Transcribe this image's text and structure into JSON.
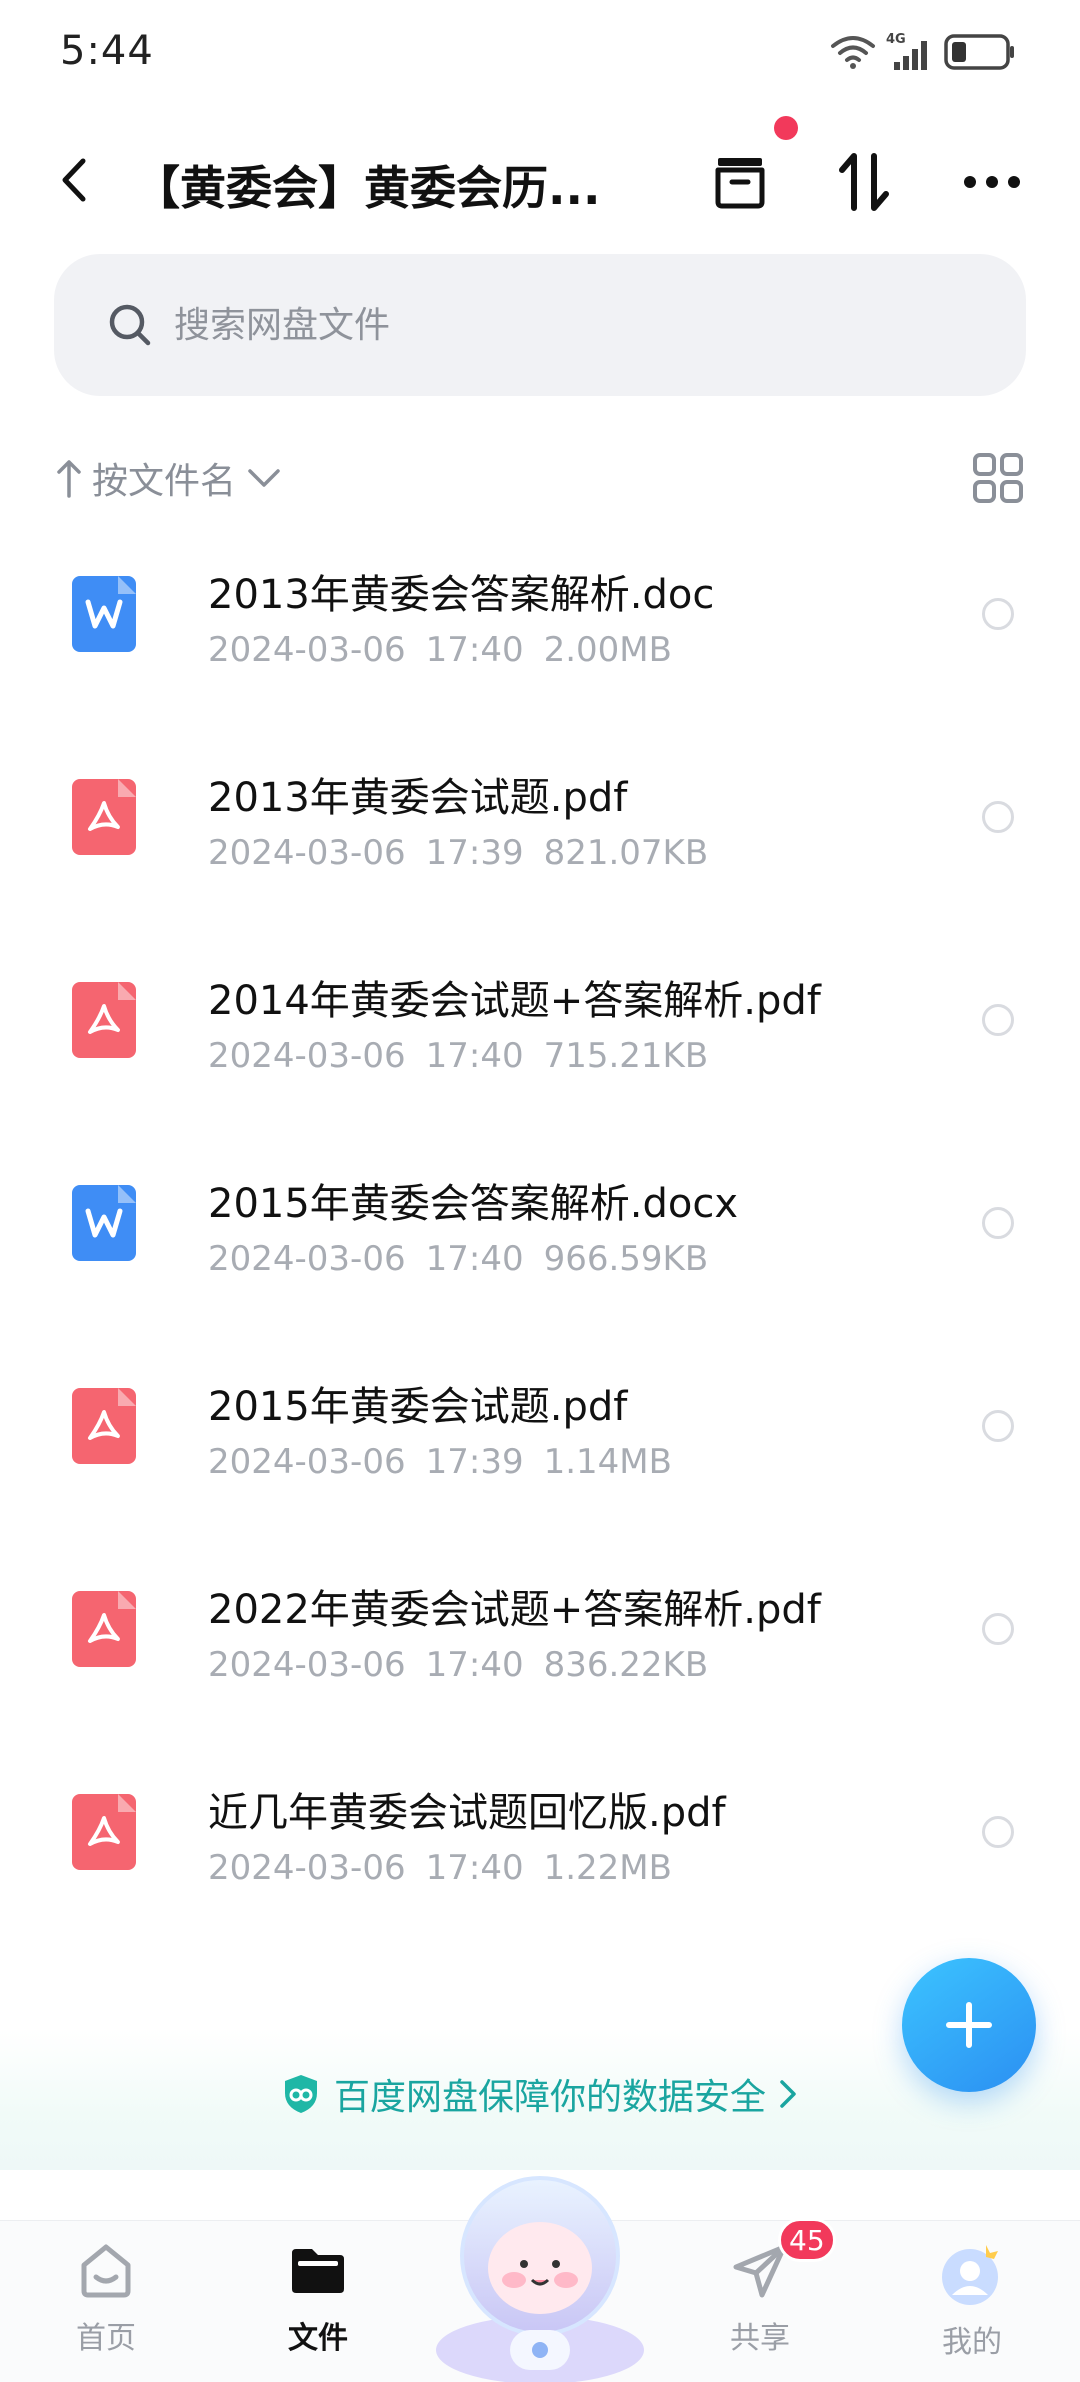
{
  "status_bar": {
    "time": "5:44",
    "network": "4G"
  },
  "header": {
    "title": "【黄委会】黄委会历..."
  },
  "search": {
    "placeholder": "搜索网盘文件"
  },
  "sort": {
    "label": "按文件名"
  },
  "files": [
    {
      "name": "2013年黄委会答案解析.doc",
      "date": "2024-03-06",
      "time": "17:40",
      "size": "2.00MB",
      "type": "word"
    },
    {
      "name": "2013年黄委会试题.pdf",
      "date": "2024-03-06",
      "time": "17:39",
      "size": "821.07KB",
      "type": "pdf"
    },
    {
      "name": "2014年黄委会试题+答案解析.pdf",
      "date": "2024-03-06",
      "time": "17:40",
      "size": "715.21KB",
      "type": "pdf"
    },
    {
      "name": "2015年黄委会答案解析.docx",
      "date": "2024-03-06",
      "time": "17:40",
      "size": "966.59KB",
      "type": "word"
    },
    {
      "name": "2015年黄委会试题.pdf",
      "date": "2024-03-06",
      "time": "17:39",
      "size": "1.14MB",
      "type": "pdf"
    },
    {
      "name": "2022年黄委会试题+答案解析.pdf",
      "date": "2024-03-06",
      "time": "17:40",
      "size": "836.22KB",
      "type": "pdf"
    },
    {
      "name": "近几年黄委会试题回忆版.pdf",
      "date": "2024-03-06",
      "time": "17:40",
      "size": "1.22MB",
      "type": "pdf"
    }
  ],
  "security_banner": {
    "text": "百度网盘保障你的数据安全"
  },
  "tabs": [
    {
      "label": "首页",
      "icon": "home-icon"
    },
    {
      "label": "文件",
      "icon": "folder-icon",
      "active": true
    },
    {
      "label": "共享",
      "icon": "send-icon",
      "badge": "45"
    },
    {
      "label": "我的",
      "icon": "avatar-icon"
    }
  ],
  "colors": {
    "accent": "#2b8ff2",
    "pdf": "#f56570",
    "word": "#3f8df5",
    "badge": "#f2395b",
    "secure": "#1aa5a0"
  }
}
